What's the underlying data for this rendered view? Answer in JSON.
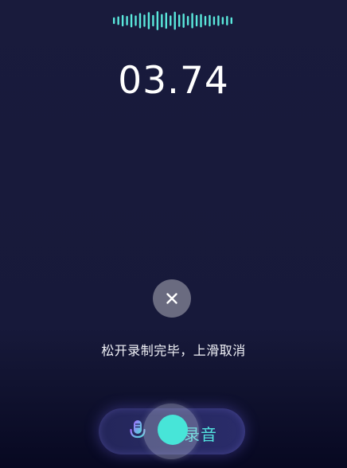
{
  "recorder": {
    "timer": "03.74",
    "hint": "松开录制完毕，上滑取消",
    "record_label": "录音",
    "cancel_icon": "close-icon",
    "mic_icon": "microphone-icon",
    "waveform_icon": "audio-waveform"
  },
  "colors": {
    "background": "#17193a",
    "accent": "#47e5d8",
    "waveform": "#5ae8dc",
    "cancel_bg": "#6a6b80",
    "record_bar": "#2a2c6a"
  },
  "waveform_levels": [
    0.35,
    0.45,
    0.6,
    0.5,
    0.7,
    0.55,
    0.8,
    0.65,
    0.9,
    0.6,
    1.0,
    0.7,
    0.85,
    0.55,
    0.95,
    0.65,
    0.75,
    0.5,
    0.8,
    0.6,
    0.7,
    0.5,
    0.6,
    0.45,
    0.55,
    0.4,
    0.5,
    0.35
  ]
}
